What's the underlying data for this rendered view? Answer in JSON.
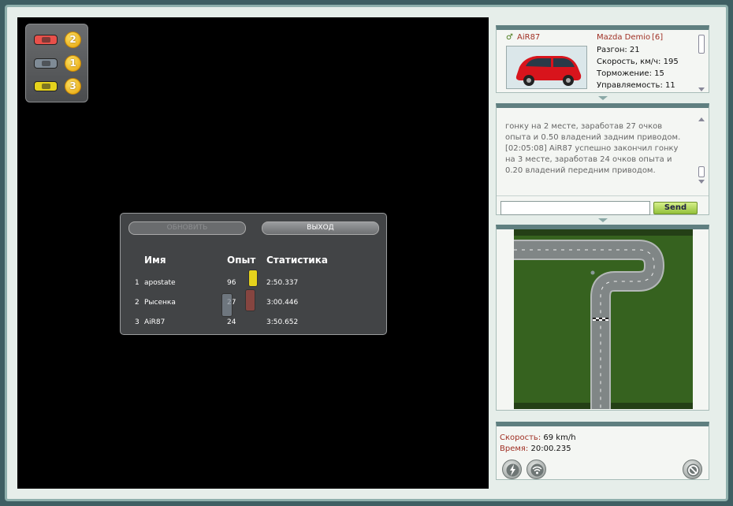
{
  "positions": [
    {
      "car_color": "#e8504a",
      "place": "2"
    },
    {
      "car_color": "#7f8b96",
      "place": "1"
    },
    {
      "car_color": "#e5d21c",
      "place": "3"
    }
  ],
  "results": {
    "refresh_label": "ОБНОВИТЬ",
    "exit_label": "ВЫХОД",
    "headers": {
      "name": "Имя",
      "exp": "Опыт",
      "stats": "Статистика"
    },
    "rows": [
      {
        "rank": "1",
        "name": "apostate",
        "exp": "96",
        "time": "2:50.337"
      },
      {
        "rank": "2",
        "name": "Рысенка",
        "exp": "27",
        "time": "3:00.446"
      },
      {
        "rank": "3",
        "name": "AiR87",
        "exp": "24",
        "time": "3:50.652"
      }
    ]
  },
  "car_info": {
    "player": "AiR87",
    "model": "Mazda Demio",
    "level": "[6]",
    "stats": [
      "Разгон: 21",
      "Скорость, км/ч: 195",
      "Торможение: 15",
      "Управляемость: 11"
    ]
  },
  "chat": {
    "lines": [
      "гонку на 2 месте, заработав 27 очков",
      "опыта и 0.50 владений задним приводом.",
      "[02:05:08] AiR87 успешно закончил гонку",
      "на 3 месте, заработав 24 очков опыта и",
      "0.20 владений передним приводом."
    ],
    "input_value": "",
    "send_label": "Send"
  },
  "hud": {
    "speed_label": "Скорость:",
    "speed_value": "69 km/h",
    "time_label": "Время:",
    "time_value": "20:00.235"
  },
  "colors": {
    "accent_red": "#a03024",
    "send_green": "#93c13a",
    "panel_border": "#5f7f80"
  },
  "icons": [
    "lightning-icon",
    "signal-icon",
    "no-entry-icon",
    "male-icon"
  ]
}
